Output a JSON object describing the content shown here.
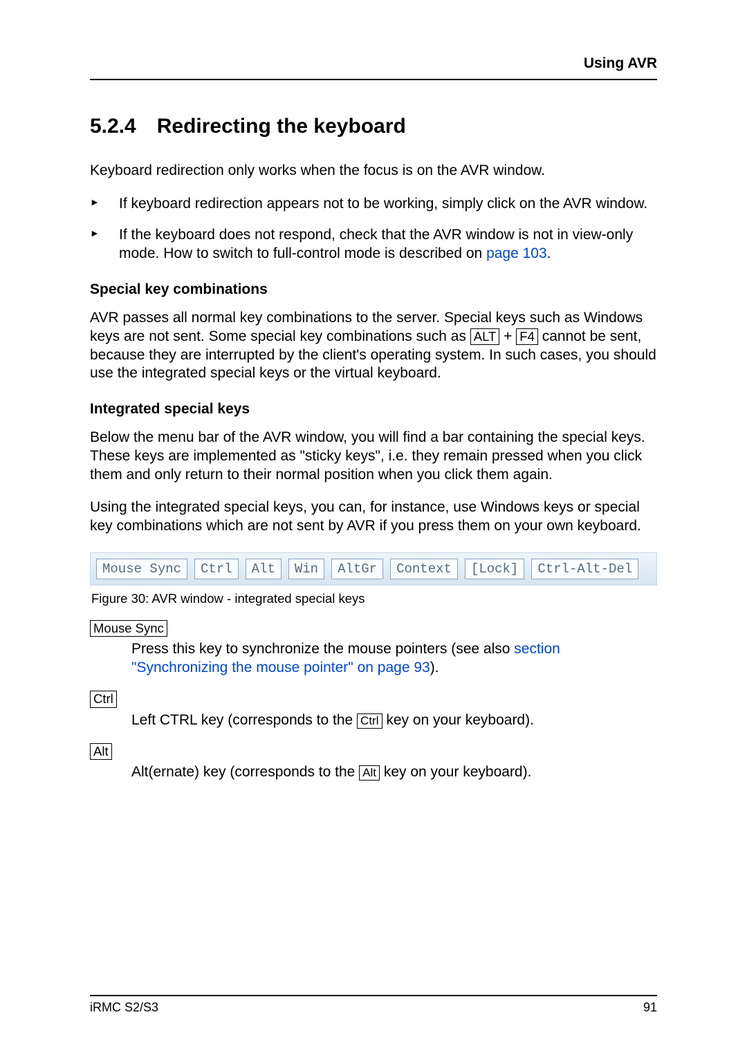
{
  "header": {
    "title": "Using AVR"
  },
  "section": {
    "number": "5.2.4",
    "title": "Redirecting the keyboard"
  },
  "intro": "Keyboard redirection only works when the focus is on the AVR window.",
  "bullets": {
    "b1": "If keyboard redirection appears not to be working, simply click on the AVR window.",
    "b2_part1": "If the keyboard does not respond, check that the AVR window is not in view-only mode. How to switch to full-control mode is described on ",
    "b2_link": "page 103",
    "b2_part3": "."
  },
  "sub1": {
    "title": "Special key combinations",
    "para_part1": "AVR passes all normal key combinations to the server. Special keys such as Windows keys are not sent. Some special key combinations such as ",
    "key1": "ALT",
    "para_plus": " + ",
    "key2": "F4",
    "para_part2": " cannot be sent, because they are interrupted by the client's operating system. In such cases, you should use the integrated special keys or the virtual keyboard."
  },
  "sub2": {
    "title": "Integrated special keys",
    "para1": "Below the menu bar of the AVR window, you will find a bar containing the special keys. These keys are implemented as \"sticky keys\", i.e. they remain pressed when you click them and only return to their normal position when you click them again.",
    "para2": "Using the integrated special keys, you can, for instance, use Windows keys or special key combinations which are not sent by AVR if you press them on your own keyboard."
  },
  "figure": {
    "buttons": {
      "b0": "Mouse Sync",
      "b1": "Ctrl",
      "b2": "Alt",
      "b3": "Win",
      "b4": "AltGr",
      "b5": "Context",
      "b6": "[Lock]",
      "b7": "Ctrl-Alt-Del"
    },
    "caption": "Figure 30:  AVR window - integrated special keys"
  },
  "defs": {
    "d1": {
      "term": "Mouse Sync",
      "body_part1": "Press this key to synchronize the mouse pointers (see also ",
      "link": "section \"Synchronizing the mouse pointer\" on page 93",
      "body_part3": ")."
    },
    "d2": {
      "term": "Ctrl",
      "body_part1": "Left CTRL key (corresponds to the ",
      "key": "Ctrl",
      "body_part2": " key on your keyboard)."
    },
    "d3": {
      "term": "Alt",
      "body_part1": " Alt(ernate) key (corresponds to the ",
      "key": "Alt",
      "body_part2": " key on your keyboard)."
    }
  },
  "footer": {
    "left": "iRMC S2/S3",
    "right": "91"
  }
}
